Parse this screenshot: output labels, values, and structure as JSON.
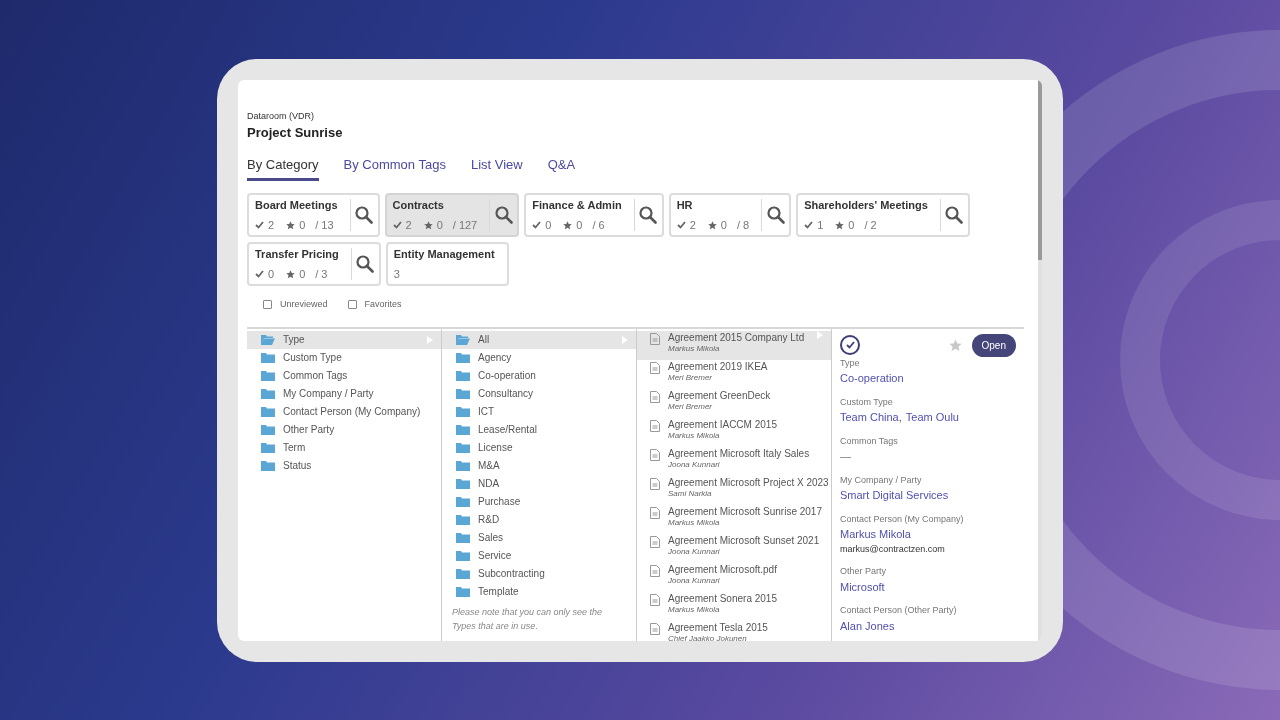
{
  "header": {
    "subtitle": "Dataroom (VDR)",
    "title": "Project Sunrise"
  },
  "tabs": [
    {
      "label": "By Category",
      "selected": true
    },
    {
      "label": "By Common Tags",
      "selected": false
    },
    {
      "label": "List View",
      "selected": false
    },
    {
      "label": "Q&A",
      "selected": false
    }
  ],
  "categories": [
    {
      "kind": "stats",
      "name": "Board Meetings",
      "reviewed": "2",
      "favorites": "0",
      "total": "/ 13",
      "selected": false
    },
    {
      "kind": "stats",
      "name": "Contracts",
      "reviewed": "2",
      "favorites": "0",
      "total": "/ 127",
      "selected": true
    },
    {
      "kind": "stats",
      "name": "Finance & Admin",
      "reviewed": "0",
      "favorites": "0",
      "total": "/ 6",
      "selected": false
    },
    {
      "kind": "stats",
      "name": "HR",
      "reviewed": "2",
      "favorites": "0",
      "total": "/ 8",
      "selected": false
    },
    {
      "kind": "stats",
      "name": "Shareholders' Meetings",
      "reviewed": "1",
      "favorites": "0",
      "total": "/ 2",
      "selected": false
    },
    {
      "kind": "stats",
      "name": "Transfer Pricing",
      "reviewed": "0",
      "favorites": "0",
      "total": "/ 3",
      "selected": false
    },
    {
      "kind": "count",
      "name": "Entity Management",
      "total": "3",
      "selected": false
    }
  ],
  "filters": [
    {
      "label": "Unreviewed",
      "checked": false
    },
    {
      "label": "Favorites",
      "checked": false
    }
  ],
  "groups": [
    {
      "label": "Type",
      "selected": true
    },
    {
      "label": "Custom Type",
      "selected": false
    },
    {
      "label": "Common Tags",
      "selected": false
    },
    {
      "label": "My Company / Party",
      "selected": false
    },
    {
      "label": "Contact Person (My Company)",
      "selected": false
    },
    {
      "label": "Other Party",
      "selected": false
    },
    {
      "label": "Term",
      "selected": false
    },
    {
      "label": "Status",
      "selected": false
    }
  ],
  "types": [
    {
      "label": "All",
      "selected": true
    },
    {
      "label": "Agency",
      "selected": false
    },
    {
      "label": "Co-operation",
      "selected": false
    },
    {
      "label": "Consultancy",
      "selected": false
    },
    {
      "label": "ICT",
      "selected": false
    },
    {
      "label": "Lease/Rental",
      "selected": false
    },
    {
      "label": "License",
      "selected": false
    },
    {
      "label": "M&A",
      "selected": false
    },
    {
      "label": "NDA",
      "selected": false
    },
    {
      "label": "Purchase",
      "selected": false
    },
    {
      "label": "R&D",
      "selected": false
    },
    {
      "label": "Sales",
      "selected": false
    },
    {
      "label": "Service",
      "selected": false
    },
    {
      "label": "Subcontracting",
      "selected": false
    },
    {
      "label": "Template",
      "selected": false
    }
  ],
  "types_note": "Please note that you can only see the Types that are in use.",
  "documents": [
    {
      "title": "Agreement 2015 Company Ltd",
      "owner": "Markus Mikola",
      "selected": true
    },
    {
      "title": "Agreement 2019 IKEA",
      "owner": "Meri Bremer",
      "selected": false
    },
    {
      "title": "Agreement GreenDeck",
      "owner": "Meri Bremer",
      "selected": false
    },
    {
      "title": "Agreement IACCM 2015",
      "owner": "Markus Mikola",
      "selected": false
    },
    {
      "title": "Agreement Microsoft Italy Sales",
      "owner": "Joona Kunnari",
      "selected": false
    },
    {
      "title": "Agreement Microsoft Project X 2023",
      "owner": "Sami Narkia",
      "selected": false
    },
    {
      "title": "Agreement Microsoft Sunrise 2017",
      "owner": "Markus Mikola",
      "selected": false
    },
    {
      "title": "Agreement Microsoft Sunset 2021",
      "owner": "Joona Kunnari",
      "selected": false
    },
    {
      "title": "Agreement Microsoft.pdf",
      "owner": "Joona Kunnari",
      "selected": false
    },
    {
      "title": "Agreement Sonera 2015",
      "owner": "Markus Mikola",
      "selected": false
    },
    {
      "title": "Agreement Tesla 2015",
      "owner": "Chief Jaakko Jokunen",
      "selected": false
    }
  ],
  "details": {
    "reviewed": true,
    "favorite": false,
    "open_button": "Open",
    "fields": [
      {
        "label": "Type",
        "values": [
          "Co-operation"
        ]
      },
      {
        "label": "Custom Type",
        "values": [
          "Team China",
          "Team Oulu"
        ],
        "separator": ","
      },
      {
        "label": "Common Tags",
        "empty": "—"
      },
      {
        "label": "My Company / Party",
        "values": [
          "Smart Digital Services"
        ]
      },
      {
        "label": "Contact Person (My Company)",
        "values": [
          "Markus Mikola"
        ],
        "note": "markus@contractzen.com"
      },
      {
        "label": "Other Party",
        "values": [
          "Microsoft"
        ]
      },
      {
        "label": "Contact Person (Other Party)",
        "values": [
          "Alan Jones"
        ]
      }
    ]
  }
}
